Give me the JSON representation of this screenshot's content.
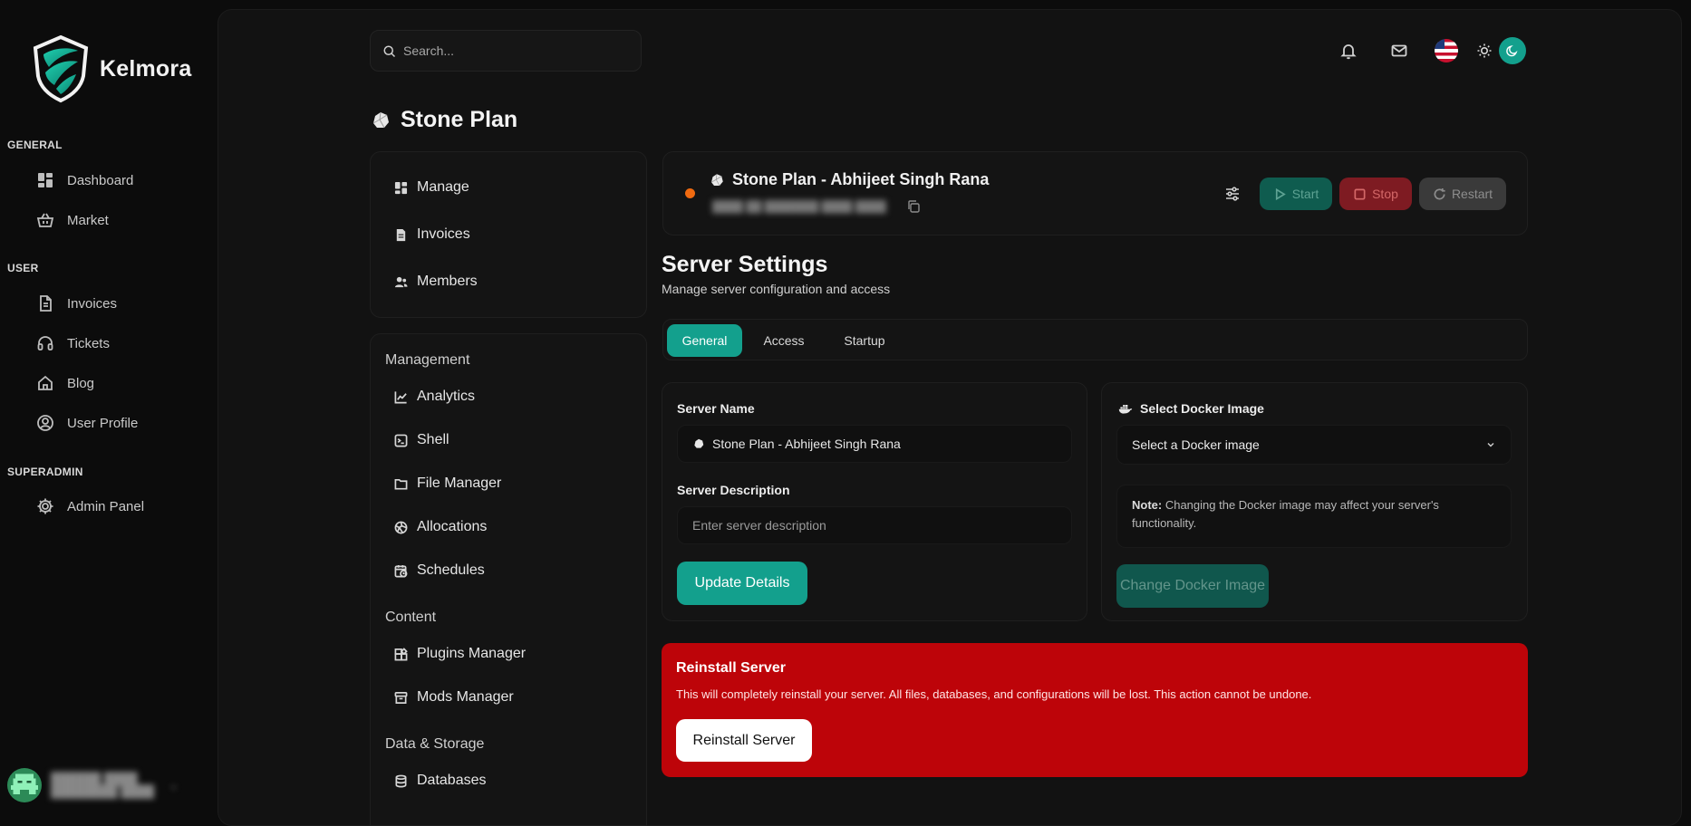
{
  "brand": {
    "name": "Kelmora"
  },
  "nav": {
    "general_label": "GENERAL",
    "user_label": "USER",
    "superadmin_label": "SUPERADMIN",
    "general": [
      {
        "label": "Dashboard",
        "icon": "dashboard-icon"
      },
      {
        "label": "Market",
        "icon": "basket-icon"
      }
    ],
    "user": [
      {
        "label": "Invoices",
        "icon": "file-icon"
      },
      {
        "label": "Tickets",
        "icon": "headset-icon"
      },
      {
        "label": "Blog",
        "icon": "home-icon"
      },
      {
        "label": "User Profile",
        "icon": "user-circle-icon"
      }
    ],
    "superadmin": [
      {
        "label": "Admin Panel",
        "icon": "gear-icon"
      }
    ]
  },
  "search": {
    "placeholder": "Search..."
  },
  "page": {
    "title": "Stone Plan"
  },
  "server_menu": {
    "top": [
      {
        "label": "Manage"
      },
      {
        "label": "Invoices"
      },
      {
        "label": "Members"
      }
    ],
    "management_label": "Management",
    "management": [
      {
        "label": "Analytics"
      },
      {
        "label": "Shell"
      },
      {
        "label": "File Manager"
      },
      {
        "label": "Allocations"
      },
      {
        "label": "Schedules"
      }
    ],
    "content_label": "Content",
    "content": [
      {
        "label": "Plugins Manager"
      },
      {
        "label": "Mods Manager"
      }
    ],
    "storage_label": "Data & Storage",
    "storage": [
      {
        "label": "Databases"
      }
    ]
  },
  "server": {
    "name": "Stone Plan - Abhijeet Singh Rana",
    "status_color": "#f06a10",
    "start_label": "Start",
    "stop_label": "Stop",
    "restart_label": "Restart"
  },
  "settings": {
    "title": "Server Settings",
    "subtitle": "Manage server configuration and access",
    "tabs": [
      {
        "label": "General",
        "active": true
      },
      {
        "label": "Access",
        "active": false
      },
      {
        "label": "Startup",
        "active": false
      }
    ],
    "server_name_label": "Server Name",
    "server_name_value": "Stone Plan - Abhijeet Singh Rana",
    "server_desc_label": "Server Description",
    "server_desc_placeholder": "Enter server description",
    "update_button": "Update Details",
    "docker_label": "Select Docker Image",
    "docker_select": "Select a Docker image",
    "note_bold": "Note:",
    "note_text": " Changing the Docker image may affect your server's functionality.",
    "change_docker_button": "Change Docker Image"
  },
  "reinstall": {
    "title": "Reinstall Server",
    "text": "This will completely reinstall your server. All files, databases, and configurations will be lost. This action cannot be undone.",
    "button": "Reinstall Server"
  },
  "colors": {
    "accent": "#13a08d",
    "danger": "#bd0409",
    "background": "#0c0c0c",
    "panel": "#121212"
  }
}
